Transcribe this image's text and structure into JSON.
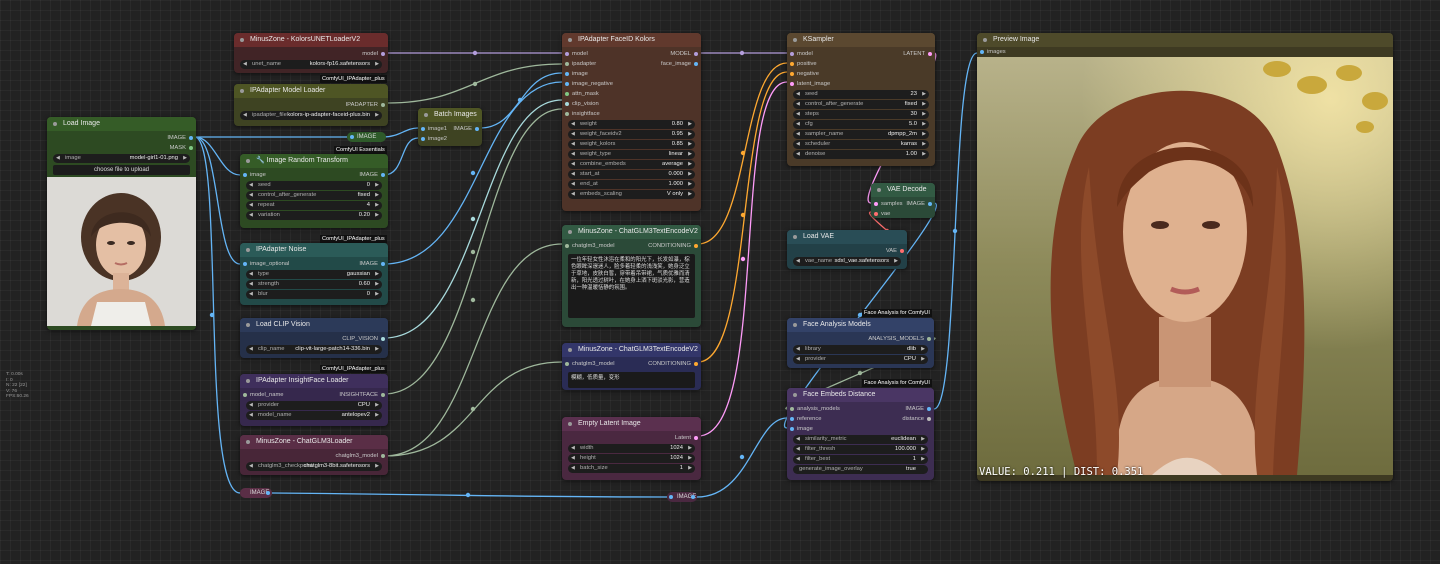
{
  "colors": {
    "canvas": "#222222",
    "wire_model": "#b39ddb",
    "wire_image": "#64b5f6",
    "wire_conditioning": "#ffa931",
    "wire_latent": "#ff9cf9",
    "wire_clip_vision": "#a8dadc",
    "wire_vae": "#ff6e6e",
    "wire_generic": "#9fb89c"
  },
  "stats": {
    "t": "T: 0.00s",
    "i": "I: 0",
    "n": "N: 22 [22]",
    "v": "V: 76",
    "fps": "FPS:60.26"
  },
  "nodes": {
    "unet_loader": {
      "title": "MinusZone - KolorsUNETLoaderV2",
      "out_model": "model",
      "w_unet_label": "unet_name",
      "w_unet_value": "kolors-fp16.safetensors"
    },
    "ipa_model_loader": {
      "tag": "ComfyUI_IPAdapter_plus",
      "title": "IPAdapter Model Loader",
      "out": "IPADAPTER",
      "w_label": "ipadapter_file",
      "w_value": "kolors-ip-adapter-faceid-plus.bin"
    },
    "load_image": {
      "title": "Load Image",
      "out_image": "IMAGE",
      "out_mask": "MASK",
      "w_label": "image",
      "w_value": "model-girl1-01.png",
      "upload": "choose file to upload"
    },
    "image_random_transform": {
      "tag": "ComfyUI Essentials",
      "title": "Image Random Transform",
      "in_image": "image",
      "out_image": "IMAGE",
      "seed_label": "seed",
      "seed_value": "0",
      "cag_label": "control_after_generate",
      "cag_value": "fixed",
      "repeat_label": "repeat",
      "repeat_value": "4",
      "variation_label": "variation",
      "variation_value": "0.20"
    },
    "ipa_noise": {
      "tag": "ComfyUI_IPAdapter_plus",
      "title": "IPAdapter Noise",
      "in_image": "image_optional",
      "out_image": "IMAGE",
      "type_label": "type",
      "type_value": "gaussian",
      "strength_label": "strength",
      "strength_value": "0.60",
      "blur_label": "blur",
      "blur_value": "0"
    },
    "load_clip_vision": {
      "title": "Load CLIP Vision",
      "out": "CLIP_VISION",
      "w_label": "clip_name",
      "w_value": "clip-vit-large-patch14-336.bin"
    },
    "insightface_loader": {
      "tag": "ComfyUI_IPAdapter_plus",
      "title": "IPAdapter InsightFace Loader",
      "in_model": "model_name",
      "out": "INSIGHTFACE",
      "provider_label": "provider",
      "provider_value": "CPU",
      "model_label": "model_name",
      "model_value": "antelopev2"
    },
    "chatglm_loader": {
      "title": "MinusZone - ChatGLM3Loader",
      "out": "chatglm3_model",
      "w_label": "chatglm3_checkpoint",
      "w_value": "chatglm3-8bit.safetensors"
    },
    "batch_images": {
      "title": "Batch Images",
      "in1": "image1",
      "in2": "image2",
      "out": "IMAGE"
    },
    "ipa_faceid": {
      "title": "IPAdapter FaceID Kolors",
      "in_model": "model",
      "in_ipadapter": "ipadapter",
      "in_image": "image",
      "in_image_negative": "image_negative",
      "in_attn_mask": "attn_mask",
      "in_clip_vision": "clip_vision",
      "in_insightface": "insightface",
      "out_model": "MODEL",
      "out_face_image": "face_image",
      "weight_label": "weight",
      "weight_value": "0.80",
      "weight_faceidv2_label": "weight_faceidv2",
      "weight_faceidv2_value": "0.95",
      "weight_kolors_label": "weight_kolors",
      "weight_kolors_value": "0.85",
      "weight_type_label": "weight_type",
      "weight_type_value": "linear",
      "combine_embeds_label": "combine_embeds",
      "combine_embeds_value": "average",
      "start_at_label": "start_at",
      "start_at_value": "0.000",
      "end_at_label": "end_at",
      "end_at_value": "1.000",
      "embeds_scaling_label": "embeds_scaling",
      "embeds_scaling_value": "V only"
    },
    "text_encode_pos": {
      "title": "MinusZone - ChatGLM3TextEncodeV2",
      "in": "chatglm3_model",
      "out": "CONDITIONING",
      "text": "一位年轻女性沐浴在柔和的阳光下，长发如瀑，棕色眼眸深邃迷人，脸多着轻柔的浅浅笑，她身泛立于草地，皮肤白皙，穿带着吊带裙，气质优雅而清新，阳光透过树叶，在她身上洒下斑驳光影，营造出一种温暖恬静的氛围。"
    },
    "text_encode_neg": {
      "title": "MinusZone - ChatGLM3TextEncodeV2",
      "in": "chatglm3_model",
      "out": "CONDITIONING",
      "text": "模糊，低质量，变形"
    },
    "empty_latent": {
      "title": "Empty Latent Image",
      "out": "Latent",
      "width_label": "width",
      "width_value": "1024",
      "height_label": "height",
      "height_value": "1024",
      "batch_label": "batch_size",
      "batch_value": "1"
    },
    "ksampler": {
      "title": "KSampler",
      "in_model": "model",
      "in_positive": "positive",
      "in_negative": "negative",
      "in_latent": "latent_image",
      "out": "LATENT",
      "seed_label": "seed",
      "seed_value": "23",
      "cag_label": "control_after_generate",
      "cag_value": "fixed",
      "steps_label": "steps",
      "steps_value": "30",
      "cfg_label": "cfg",
      "cfg_value": "5.0",
      "sampler_label": "sampler_name",
      "sampler_value": "dpmpp_2m",
      "scheduler_label": "scheduler",
      "scheduler_value": "karras",
      "denoise_label": "denoise",
      "denoise_value": "1.00"
    },
    "vae_decode": {
      "title": "VAE Decode",
      "in_samples": "samples",
      "in_vae": "vae",
      "out": "IMAGE"
    },
    "load_vae": {
      "title": "Load VAE",
      "out": "VAE",
      "w_label": "vae_name",
      "w_value": "sdxl_vae.safetensors"
    },
    "face_analysis_models": {
      "tag": "Face Analysis for ComfyUI",
      "title": "Face Analysis Models",
      "out": "ANALYSIS_MODELS",
      "library_label": "library",
      "library_value": "dlib",
      "provider_label": "provider",
      "provider_value": "CPU"
    },
    "face_embeds_distance": {
      "tag": "Face Analysis for ComfyUI",
      "title": "Face Embeds Distance",
      "in_models": "analysis_models",
      "in_reference": "reference",
      "in_image": "image",
      "out_image": "IMAGE",
      "out_distance": "distance",
      "metric_label": "similarity_metric",
      "metric_value": "euclidean",
      "filter_thresh_label": "filter_thresh",
      "filter_thresh_value": "100.000",
      "filter_best_label": "filter_best",
      "filter_best_value": "1",
      "overlay_label": "generate_image_overlay",
      "overlay_value": "true"
    },
    "preview_image": {
      "title": "Preview Image",
      "in": "images",
      "overlay_text": "VALUE: 0.211 | DIST: 0.351"
    }
  },
  "reroutes": {
    "image_mid": "IMAGE",
    "image_bottom_left": "IMAGE",
    "image_bottom_mid": "IMAGE"
  }
}
